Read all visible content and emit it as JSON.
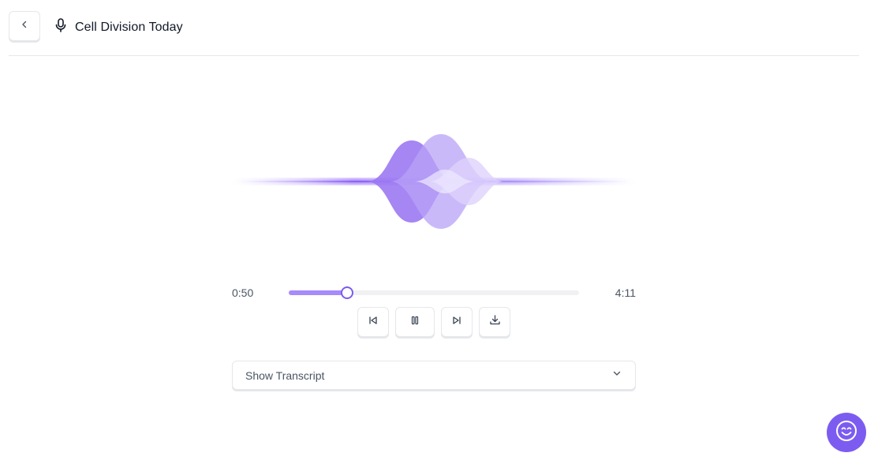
{
  "header": {
    "back_icon": "chevron-left-icon",
    "mic_icon": "microphone-icon",
    "title": "Cell Division Today"
  },
  "player": {
    "current_time": "0:50",
    "duration": "4:11",
    "progress": 0.2,
    "accent": "#7c5cf0",
    "progress_fill": "#a78bfa"
  },
  "controls": {
    "prev_icon": "skip-back-icon",
    "pause_icon": "pause-icon",
    "next_icon": "skip-forward-icon",
    "download_icon": "download-icon"
  },
  "transcript": {
    "label": "Show Transcript",
    "icon": "chevron-down-icon"
  },
  "assistant": {
    "icon": "smile-icon"
  }
}
